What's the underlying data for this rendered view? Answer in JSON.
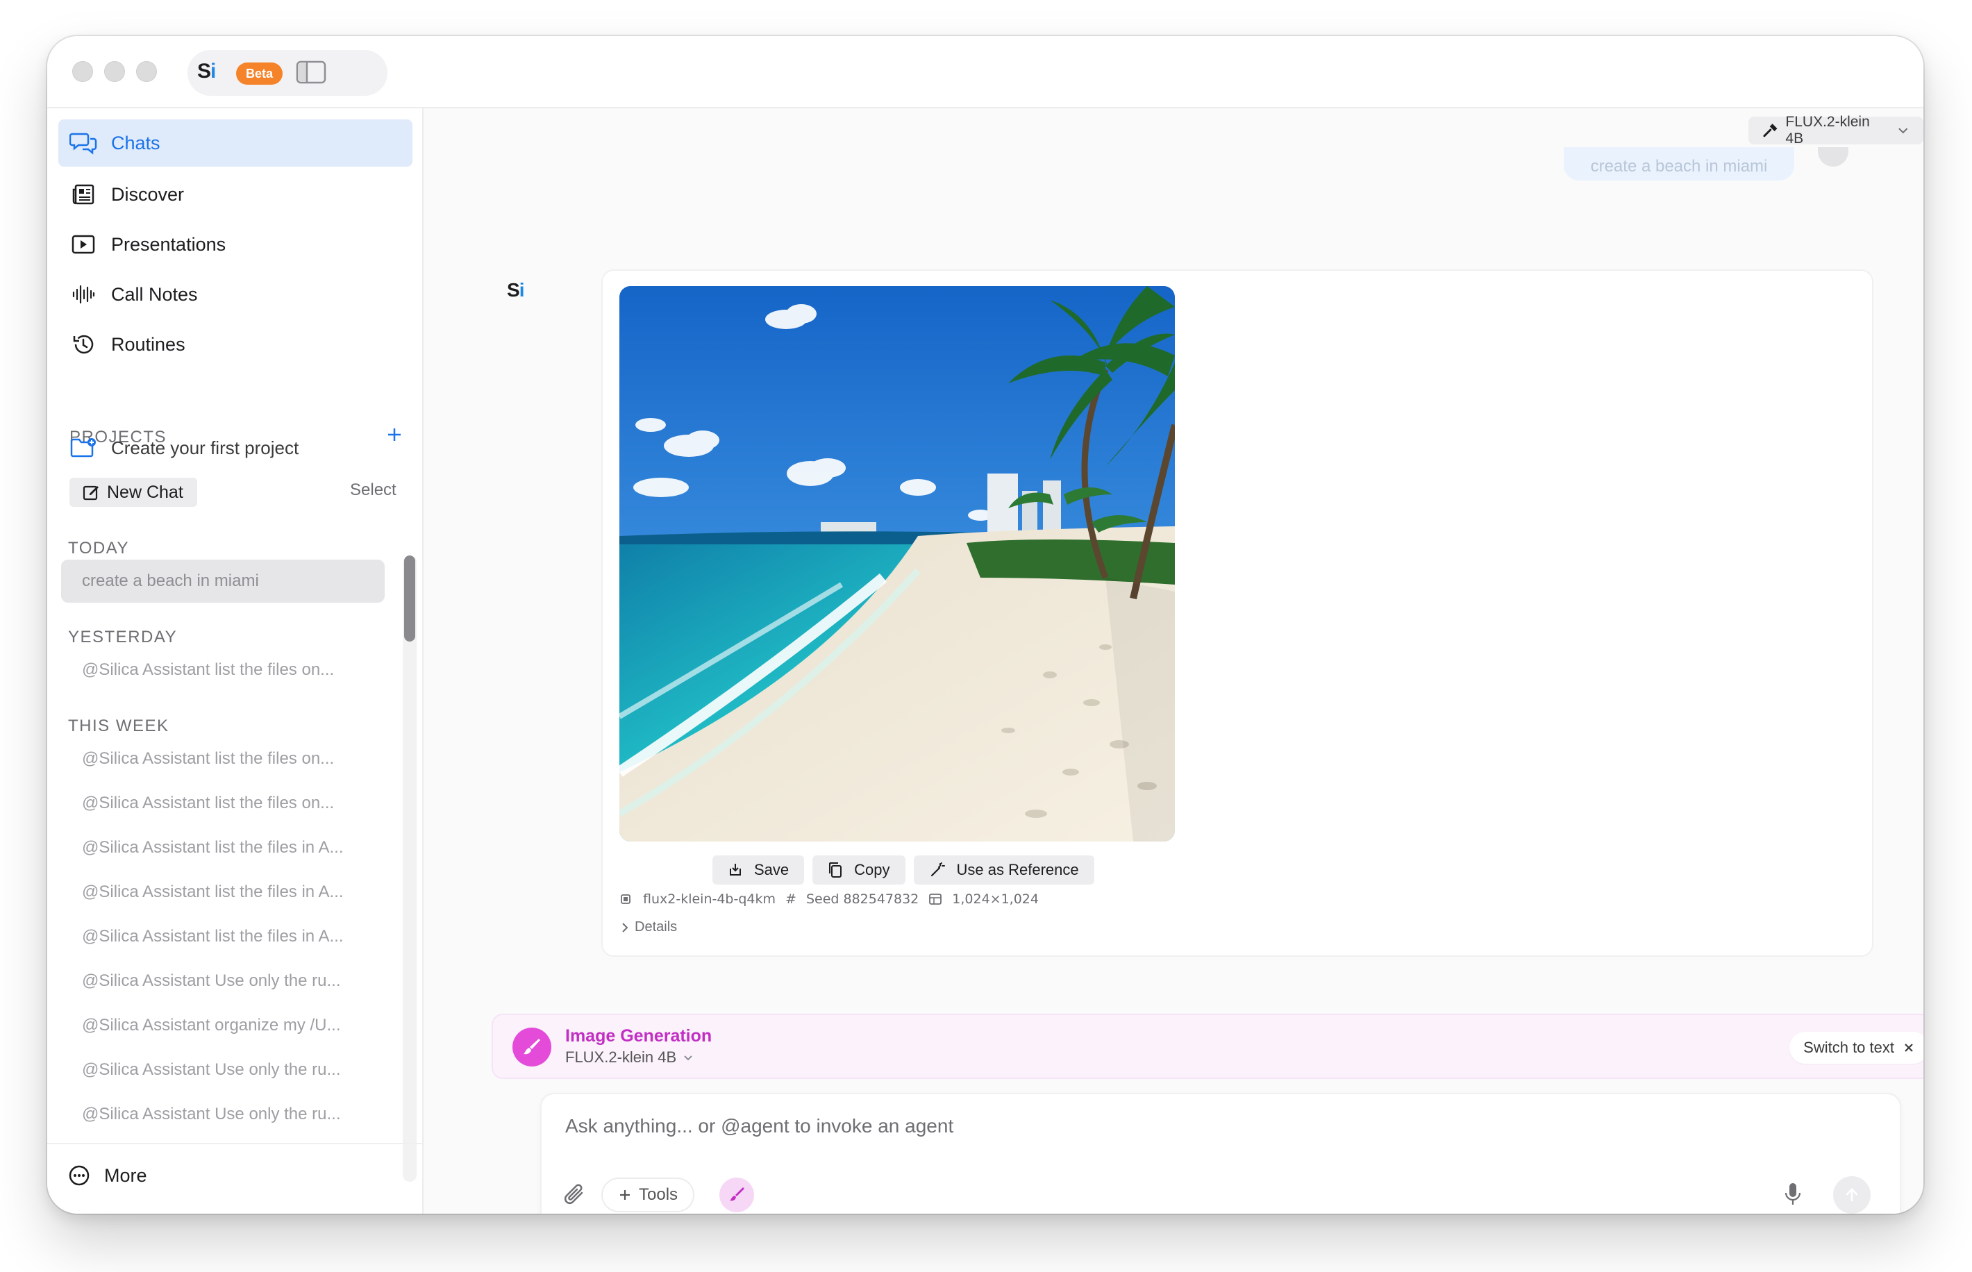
{
  "app": {
    "logo_s": "S",
    "logo_i": "i",
    "beta_label": "Beta"
  },
  "colors": {
    "accent": "#1a73e8",
    "beta": "#f5832a",
    "image_gen": "#c22fc3",
    "brush_bg": "#e34bd8"
  },
  "sidebar": {
    "nav": [
      {
        "label": "Chats",
        "icon": "chats-icon",
        "active": true
      },
      {
        "label": "Discover",
        "icon": "newspaper-icon"
      },
      {
        "label": "Presentations",
        "icon": "play-icon"
      },
      {
        "label": "Call Notes",
        "icon": "waveform-icon"
      },
      {
        "label": "Routines",
        "icon": "history-icon"
      }
    ],
    "projects_header": "PROJECTS",
    "create_project": "Create your first project",
    "new_chat": "New Chat",
    "select": "Select",
    "groups": {
      "today": {
        "header": "TODAY",
        "items": [
          "create a beach in miami"
        ]
      },
      "yesterday": {
        "header": "YESTERDAY",
        "items": [
          "@Silica Assistant list the files on..."
        ]
      },
      "this_week": {
        "header": "THIS WEEK",
        "items": [
          "@Silica Assistant list the files on...",
          "@Silica Assistant list the files on...",
          "@Silica Assistant list the files in A...",
          "@Silica Assistant list the files in A...",
          "@Silica Assistant list the files in A...",
          "@Silica Assistant Use only the ru...",
          "@Silica Assistant organize my /U...",
          "@Silica Assistant Use only the ru...",
          "@Silica Assistant Use only the ru..."
        ]
      }
    },
    "more": "More"
  },
  "main": {
    "model_selector": "FLUX.2-klein 4B",
    "user_message": "create a beach in miami",
    "assistant": {
      "actions": [
        "Save",
        "Copy",
        "Use as Reference"
      ],
      "meta": {
        "model": "flux2-klein-4b-q4km",
        "seed_label": "Seed 882547832",
        "size": "1,024×1,024"
      },
      "details": "Details"
    },
    "image_generation": {
      "title": "Image Generation",
      "model": "FLUX.2-klein 4B",
      "switch": "Switch to text"
    },
    "composer": {
      "placeholder": "Ask anything... or @agent to invoke an agent",
      "tools": "Tools"
    }
  }
}
